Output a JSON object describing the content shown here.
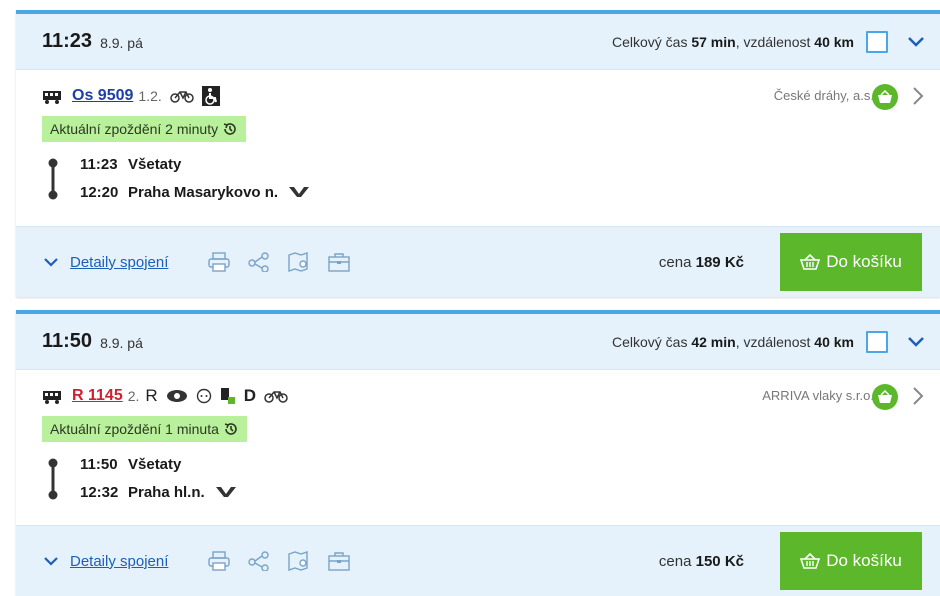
{
  "connections": [
    {
      "time": "11:23",
      "date": "8.9. pá",
      "total_prefix": "Celkový čas ",
      "duration": "57 min",
      "distance_prefix": ", vzdálenost ",
      "distance": "40 km",
      "train_number": "Os 9509",
      "classes": "1.2.",
      "carrier": "České dráhy, a.s.",
      "delay": "Aktuální zpoždění 2 minuty",
      "stops": [
        {
          "time": "11:23",
          "name": "Všetaty"
        },
        {
          "time": "12:20",
          "name": "Praha Masarykovo n."
        }
      ],
      "details_label": "Detaily spojení",
      "price_prefix": "cena ",
      "price": "189 Kč",
      "buy_label": "Do košíku"
    },
    {
      "time": "11:50",
      "date": "8.9. pá",
      "total_prefix": "Celkový čas ",
      "duration": "42 min",
      "distance_prefix": ", vzdálenost ",
      "distance": "40 km",
      "train_number": "R 1145",
      "classes": "2.",
      "class_letter": "R",
      "d_letter": "D",
      "carrier": "ARRIVA vlaky s.r.o.",
      "delay": "Aktuální zpoždění 1 minuta",
      "stops": [
        {
          "time": "11:50",
          "name": "Všetaty"
        },
        {
          "time": "12:32",
          "name": "Praha hl.n."
        }
      ],
      "details_label": "Detaily spojení",
      "price_prefix": "cena ",
      "price": "150 Kč",
      "buy_label": "Do košíku"
    }
  ],
  "colors": {
    "accent": "#4aa6e6",
    "header_bg": "#e5f2fb",
    "buy_green": "#5cb82a",
    "delay_green": "#b9f09b",
    "link_blue": "#1c5fb8",
    "os_blue": "#1c3fa8",
    "r_red": "#d01f2e"
  },
  "icons": [
    "train-icon",
    "bicycle-icon",
    "wheelchair-icon",
    "history-icon",
    "metro-icon",
    "chevron-down-icon",
    "chevron-right-icon",
    "basket-icon",
    "print-icon",
    "share-icon",
    "map-icon",
    "briefcase-icon",
    "refreshment-icon",
    "compass-icon",
    "info-icon"
  ]
}
